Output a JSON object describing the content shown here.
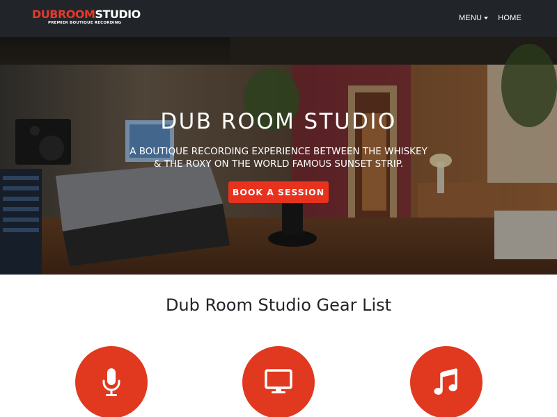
{
  "brand": {
    "part1": "DUBROOM",
    "part2": "STUDIO",
    "tagline": "PREMIER BOUTIQUE RECORDING"
  },
  "nav": {
    "menu_label": "MENU",
    "home_label": "HOME"
  },
  "hero": {
    "title": "DUB ROOM STUDIO",
    "subtitle_line1": "A BOUTIQUE RECORDING EXPERIENCE BETWEEN THE WHISKEY",
    "subtitle_line2": "& THE ROXY ON THE WORLD FAMOUS SUNSET STRIP.",
    "cta_label": "BOOK A SESSION"
  },
  "gear": {
    "heading": "Dub Room Studio Gear List",
    "icons": [
      "microphone-icon",
      "monitor-icon",
      "music-note-icon"
    ]
  },
  "colors": {
    "accent": "#e8392a",
    "navbar": "#212529",
    "circle": "#e0391f"
  }
}
